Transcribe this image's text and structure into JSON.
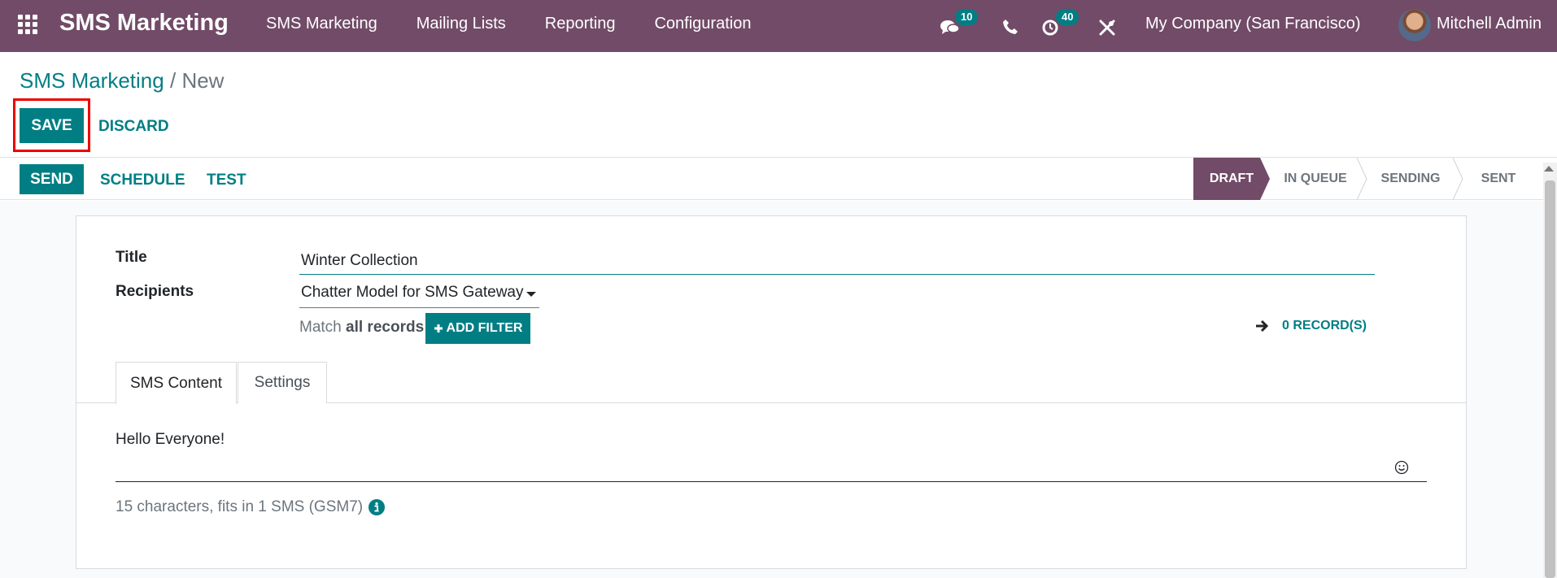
{
  "navbar": {
    "brand": "SMS Marketing",
    "menu": [
      "SMS Marketing",
      "Mailing Lists",
      "Reporting",
      "Configuration"
    ],
    "messages_badge": "10",
    "activities_badge": "40",
    "company": "My Company (San Francisco)",
    "user": "Mitchell Admin",
    "icons": [
      "apps-grid-icon",
      "chat-icon",
      "phone-icon",
      "clock-icon",
      "tools-icon"
    ]
  },
  "breadcrumb": {
    "parent": "SMS Marketing",
    "separator": "/",
    "current": "New"
  },
  "actions": {
    "save": "SAVE",
    "discard": "DISCARD"
  },
  "header": {
    "send": "SEND",
    "schedule": "SCHEDULE",
    "test": "TEST",
    "stages": [
      "DRAFT",
      "IN QUEUE",
      "SENDING",
      "SENT"
    ],
    "active_stage": "DRAFT"
  },
  "form": {
    "title_label": "Title",
    "title_value": "Winter Collection",
    "recipients_label": "Recipients",
    "recipients_value": "Chatter Model for SMS Gateway",
    "match_prefix": "Match",
    "match_bold": "all records",
    "add_filter": "ADD FILTER",
    "records": "0 RECORD(S)",
    "tabs": [
      "SMS Content",
      "Settings"
    ],
    "sms_body": "Hello Everyone!",
    "char_count": "15 characters, fits in 1 SMS (GSM7)"
  },
  "colors": {
    "brand_purple": "#714b67",
    "accent_teal": "#017e84",
    "highlight_red": "#ee0000"
  }
}
